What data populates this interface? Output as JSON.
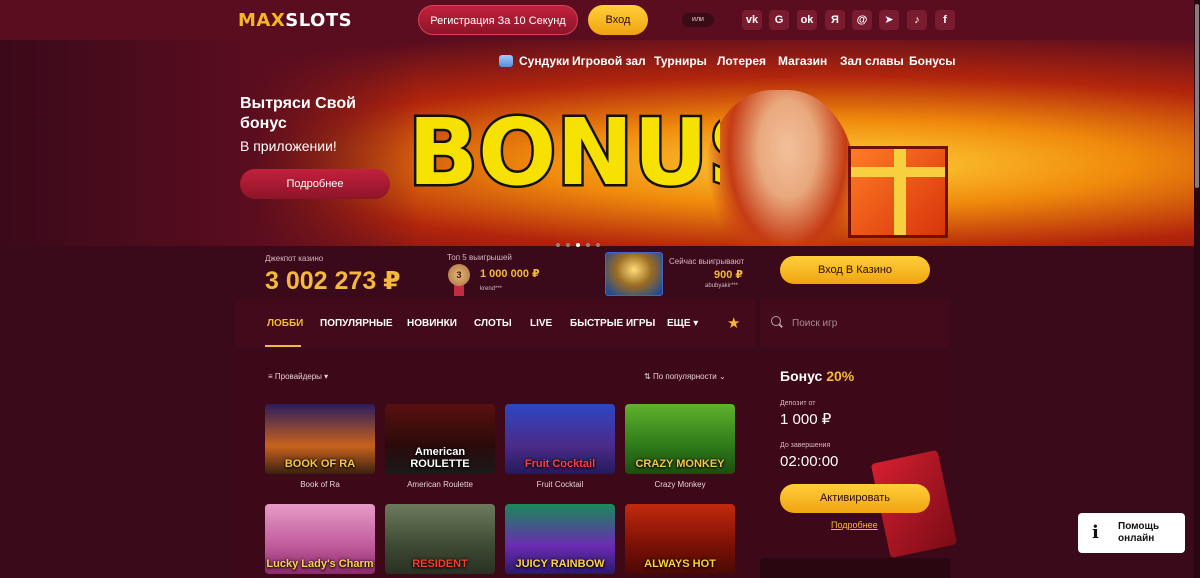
{
  "header": {
    "logo_max": "MAX",
    "logo_slots": "SLOTS",
    "register_label": "Регистрация За 10 Секунд",
    "login_label": "Вход",
    "or_label": "или",
    "social": [
      {
        "icon": "vk-icon",
        "glyph": "vk",
        "color": "#7a1c30"
      },
      {
        "icon": "google-icon",
        "glyph": "G",
        "color": "#7a1c30"
      },
      {
        "icon": "odnoklassniki-icon",
        "glyph": "ok",
        "color": "#7a1c30"
      },
      {
        "icon": "yandex-icon",
        "glyph": "Я",
        "color": "#7a1c30"
      },
      {
        "icon": "mail-icon",
        "glyph": "@",
        "color": "#7a1c30"
      },
      {
        "icon": "telegram-icon",
        "glyph": "➤",
        "color": "#7a1c30"
      },
      {
        "icon": "tiktok-icon",
        "glyph": "♪",
        "color": "#7a1c30"
      },
      {
        "icon": "facebook-icon",
        "glyph": "f",
        "color": "#7a1c30"
      }
    ]
  },
  "nav": {
    "items": [
      "Сундуки",
      "Игровой зал",
      "Турниры",
      "Лотерея",
      "Магазин",
      "Зал славы",
      "Бонусы"
    ]
  },
  "hero": {
    "title": "Вытряси Свой бонус",
    "subtitle": "В приложении!",
    "button_label": "Подробнее",
    "banner_word": "BONUS!"
  },
  "jackpot": {
    "label": "Джекпот казино",
    "value": "3 002 273 ₽"
  },
  "top5": {
    "label": "Топ 5 выигрышей",
    "place": "3",
    "amount": "1 000 000 ₽",
    "user": "krend***"
  },
  "now_winning": {
    "label": "Сейчас выигрывают",
    "amount": "900 ₽",
    "user": "abubyakir***"
  },
  "enter_casino_label": "Вход В Казино",
  "categories": {
    "items": [
      "ЛОББИ",
      "ПОПУЛЯРНЫЕ",
      "НОВИНКИ",
      "СЛОТЫ",
      "LIVE",
      "БЫСТРЫЕ ИГРЫ",
      "ЕЩЕ ▾"
    ],
    "active": "ЛОББИ"
  },
  "search": {
    "placeholder": "Поиск игр",
    "value": ""
  },
  "filters": {
    "providers_label": "Провайдеры",
    "sort_label": "По популярности"
  },
  "games": [
    {
      "name": "Book of Ra",
      "art_text": "BOOK OF RA"
    },
    {
      "name": "American Roulette",
      "art_text": "American ROULETTE"
    },
    {
      "name": "Fruit Cocktail",
      "art_text": "Fruit Cocktail"
    },
    {
      "name": "Crazy Monkey",
      "art_text": "CRAZY MONKEY"
    },
    {
      "name": "",
      "art_text": "Lucky Lady's Charm"
    },
    {
      "name": "",
      "art_text": "RESIDENT"
    },
    {
      "name": "",
      "art_text": "JUICY RAINBOW"
    },
    {
      "name": "",
      "art_text": "ALWAYS HOT"
    }
  ],
  "bonus_card": {
    "title": "Бонус",
    "percent": "20%",
    "deposit_label": "Депозит от",
    "deposit_value": "1 000 ₽",
    "until_label": "До завершения",
    "until_value": "02:00:00",
    "activate_label": "Активировать",
    "details_label": "Подробнее"
  },
  "help": {
    "icon_glyph": "i",
    "label": "Помощь онлайн"
  },
  "colors": {
    "accent_gold": "#f4b93b",
    "brand_red": "#c2213c",
    "background": "#3a0a1a"
  }
}
